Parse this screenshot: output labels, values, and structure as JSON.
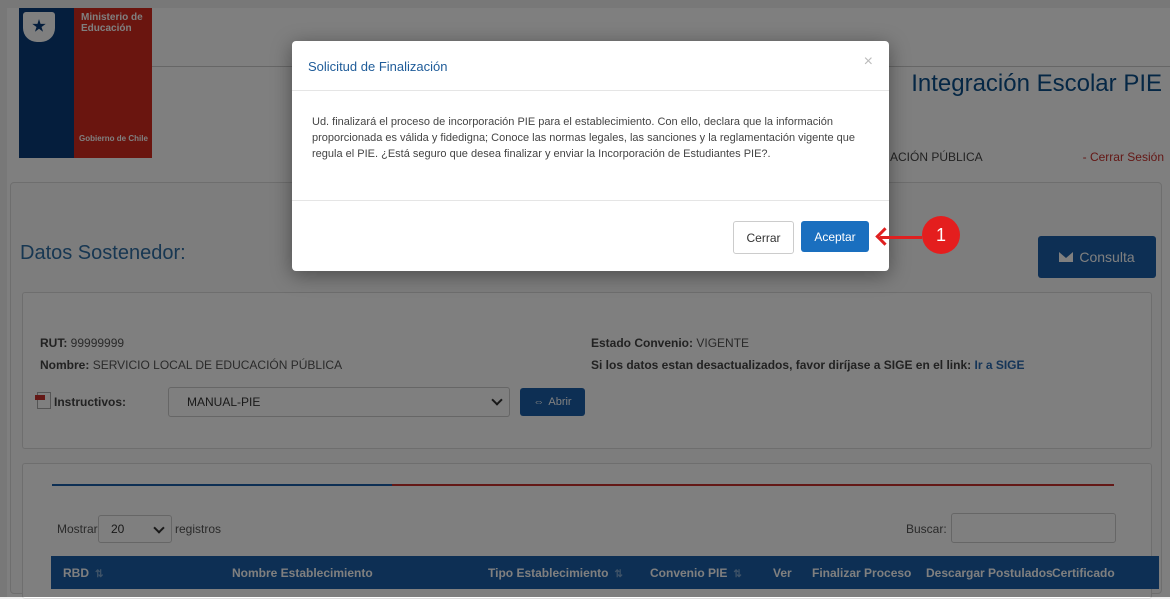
{
  "brand": {
    "ministry": "Ministerio de Educación",
    "footer": "Gobierno de Chile"
  },
  "header": {
    "app_title": "Integración Escolar PIE",
    "nav_item": "ACIÓN PÚBLICA",
    "logout": "- Cerrar Sesión"
  },
  "section": {
    "title": "Datos Sostenedor:",
    "consulta_button": "Consulta"
  },
  "info": {
    "rut_label": "RUT:",
    "rut_value": "99999999",
    "nombre_label": "Nombre:",
    "nombre_value": "SERVICIO LOCAL DE EDUCACIÓN PÚBLICA",
    "estado_label": "Estado Convenio:",
    "estado_value": "VIGENTE",
    "sige_text": "Si los datos estan desactualizados, favor diríjase a SIGE en el link:",
    "sige_link": "Ir a SIGE",
    "instructivos_label": "Instructivos:",
    "instructivos_selected": "MANUAL-PIE",
    "abrir_button": "Abrir"
  },
  "table": {
    "show_label": "Mostrar",
    "page_size": "20",
    "records_label": "registros",
    "search_label": "Buscar:",
    "columns": [
      "RBD",
      "Nombre Establecimiento",
      "Tipo Establecimiento",
      "Convenio PIE",
      "Ver",
      "Finalizar Proceso",
      "Descargar Postulados",
      "Certificado"
    ]
  },
  "modal": {
    "title": "Solicitud de Finalización",
    "close": "×",
    "body": "Ud. finalizará el proceso de incorporación PIE para el establecimiento. Con ello, declara que la información proporcionada es válida y fidedigna; Conoce las normas legales, las sanciones y la reglamentación vigente que regula el PIE. ¿Está seguro que desea finalizar y enviar la Incorporación de Estudiantes PIE?.",
    "cancel": "Cerrar",
    "accept": "Aceptar"
  },
  "annotation": {
    "step": "1"
  },
  "colors": {
    "primary": "#1a5fa8",
    "danger": "#c9302c",
    "badge": "#e41e1e"
  }
}
